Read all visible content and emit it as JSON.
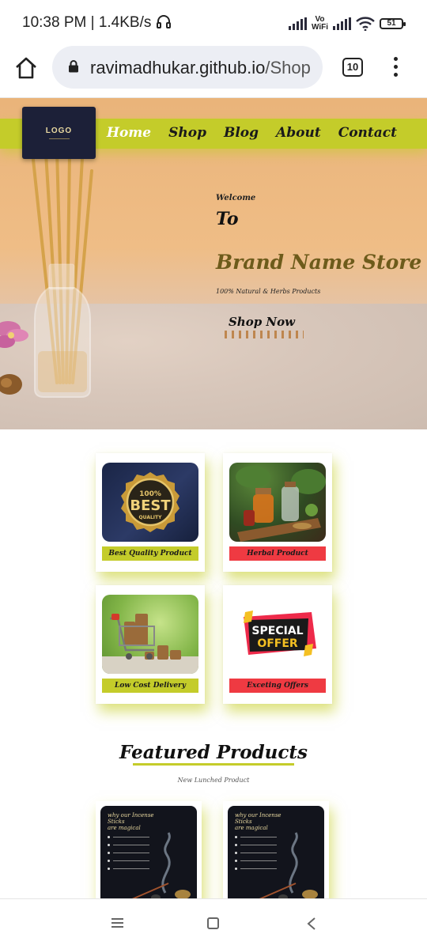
{
  "status_bar": {
    "time_speed": "10:38 PM | 1.4KB/s",
    "vowifi": [
      "Vo",
      "WiFi"
    ],
    "battery": "51"
  },
  "browser": {
    "url_domain": "ravimadhukar.github.io",
    "url_path": "/Shop",
    "tab_count": "10"
  },
  "site": {
    "logo": "LOGO",
    "nav": [
      "Home",
      "Shop",
      "Blog",
      "About",
      "Contact"
    ],
    "hero": {
      "welcome": "Welcome",
      "to": "To",
      "brand": "Brand Name Store",
      "tagline": "100% Natural & Herbs Products",
      "cta": "Shop Now"
    },
    "features": [
      {
        "label": "Best Quality Product",
        "badge_top": "100%",
        "badge_main": "BEST",
        "badge_sub": "QUALITY"
      },
      {
        "label": "Herbal Product"
      },
      {
        "label": "Low Cost Delivery"
      },
      {
        "label": "Exceting Offers",
        "offer_line1": "SPECIAL",
        "offer_line2": "OFFER"
      }
    ],
    "featured": {
      "title": "Featured Products",
      "subtitle": "New Lunched Product",
      "card_title": [
        "why our Incense",
        "Sticks",
        "are magical"
      ]
    }
  },
  "colors": {
    "accent_green": "#c4cc2a",
    "accent_red": "#ef3a42",
    "brand_text": "#6d5b1b"
  },
  "icons": {
    "browser_home": "home-icon",
    "lock": "lock-icon",
    "overflow": "kebab-menu-icon",
    "system_menu": "recent-apps-icon",
    "system_home": "square-home-icon",
    "system_back": "back-chevron-icon"
  }
}
